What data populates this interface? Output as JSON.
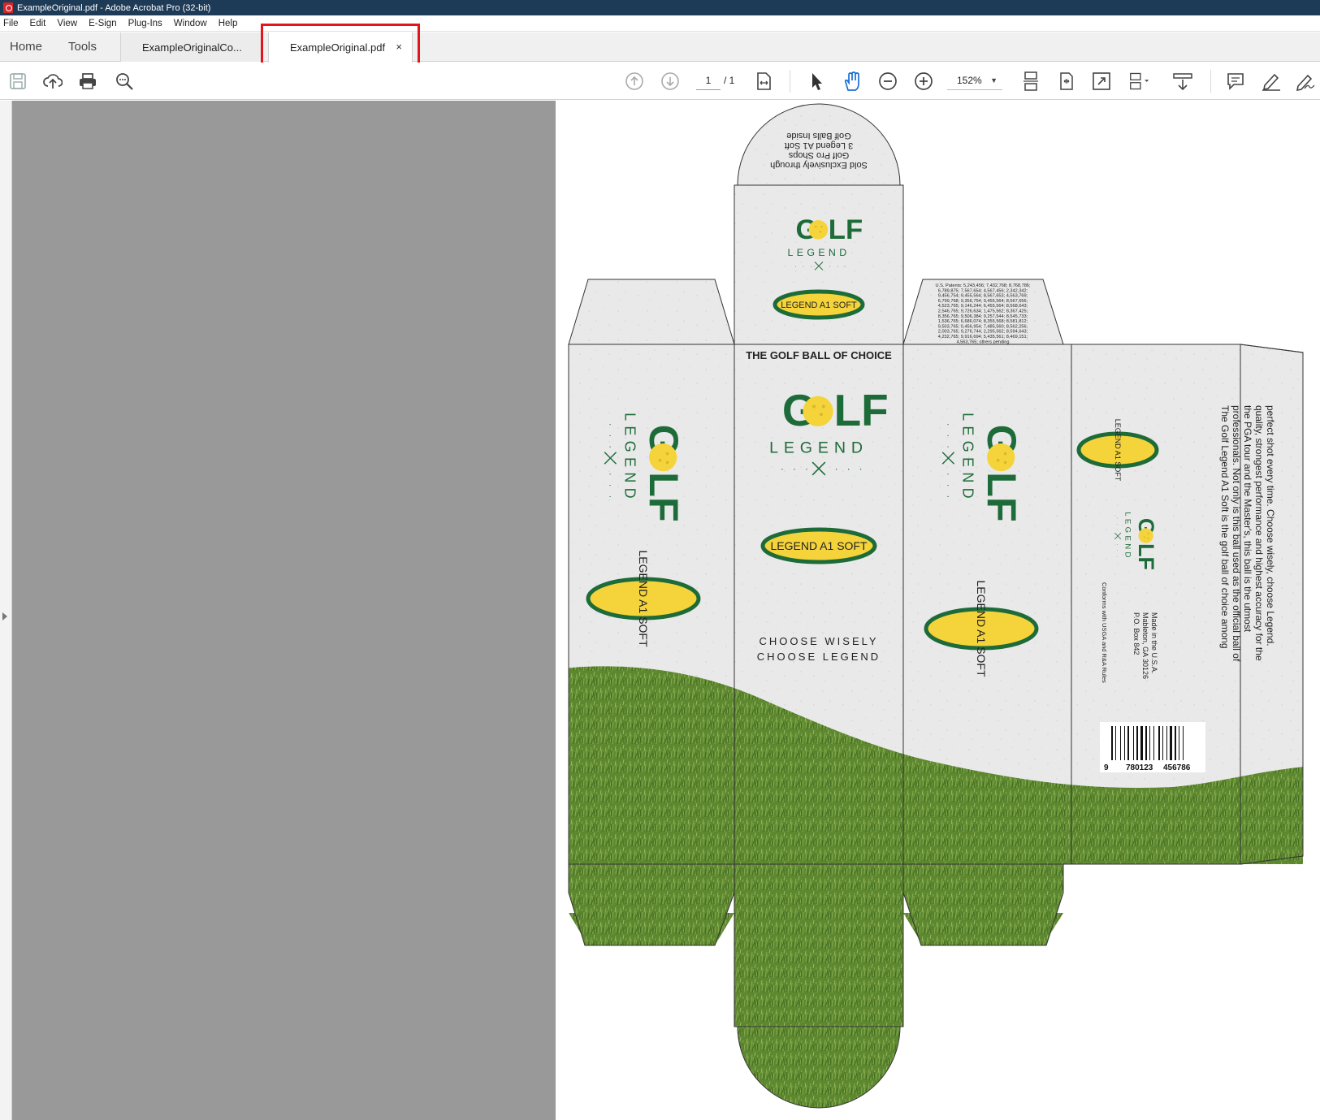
{
  "window": {
    "title": "ExampleOriginal.pdf - Adobe Acrobat Pro (32-bit)"
  },
  "menu": [
    "File",
    "Edit",
    "View",
    "E-Sign",
    "Plug-Ins",
    "Window",
    "Help"
  ],
  "tabs": {
    "home": "Home",
    "tools": "Tools",
    "doc1": "ExampleOriginalCo...",
    "doc2": "ExampleOriginal.pdf",
    "close": "×"
  },
  "toolbar": {
    "page_current": "1",
    "page_total": "/ 1",
    "zoom": "152%"
  },
  "box": {
    "top_flap_lines": [
      "Sold Exclusively through",
      "Golf Pro Shops",
      "3 Legend A1 Soft",
      "Golf Balls Inside"
    ],
    "logo_golf": "GOLF",
    "logo_legend": "LEGEND",
    "badge": "LEGEND A1 SOFT",
    "front_header": "THE GOLF BALL OF CHOICE",
    "choose1": "CHOOSE WISELY",
    "choose2": "CHOOSE LEGEND",
    "patents": [
      "U.S. Patents: 5,243,456; 7,432,768; 8,768,786;",
      "6,789,875; 7,567,654; 4,567,456; 2,342,342;",
      "9,456,754; 9,455,564; 8,567,653; 4,563,769;",
      "6,799,768; 9,356,754; 9,455,564; 8,567,656;",
      "4,523,765; 9,146,244; 6,455,564; 8,568,643;",
      "2,546,765; 9,726,634; 1,475,562; 8,367,425;",
      "8,356,765; 9,506,384; 9,257,544; 8,545,733;",
      "1,536,765; 6,686,074; 8,355,568; 8,581,812;",
      "9,503,765; 0,456,954; 7,485,560; 8,562,256;",
      "2,003,765; 9,276,744; 2,295,562; 8,594,643;",
      "4,232,765; 9,916,694; 5,435,561; 8,469,151;",
      "4,563,765; others pending"
    ],
    "description": [
      "The Golf Legend A1 Soft is the golf ball of choice among",
      "professionals. Not only is this ball used as the official ball of",
      "the PGA tour and the Master's, this ball is the utmost",
      "quality, strongest performance and highest accuracy for the",
      "perfect shot every time. Choose wisely, choose Legend."
    ],
    "address": [
      "P.O. Box 842",
      "Mableton, GA 30126",
      "Made in the U.S.A."
    ],
    "conforms": "Conforms with USGA and R&A Rules",
    "barcode_digits": [
      "9",
      "780123",
      "456786"
    ]
  },
  "colors": {
    "green": "#1e6b3a",
    "yellow": "#f4d43a",
    "grass": "#5f8a2e",
    "title_bg": "#1d3a56",
    "highlight": "#e3151a"
  }
}
